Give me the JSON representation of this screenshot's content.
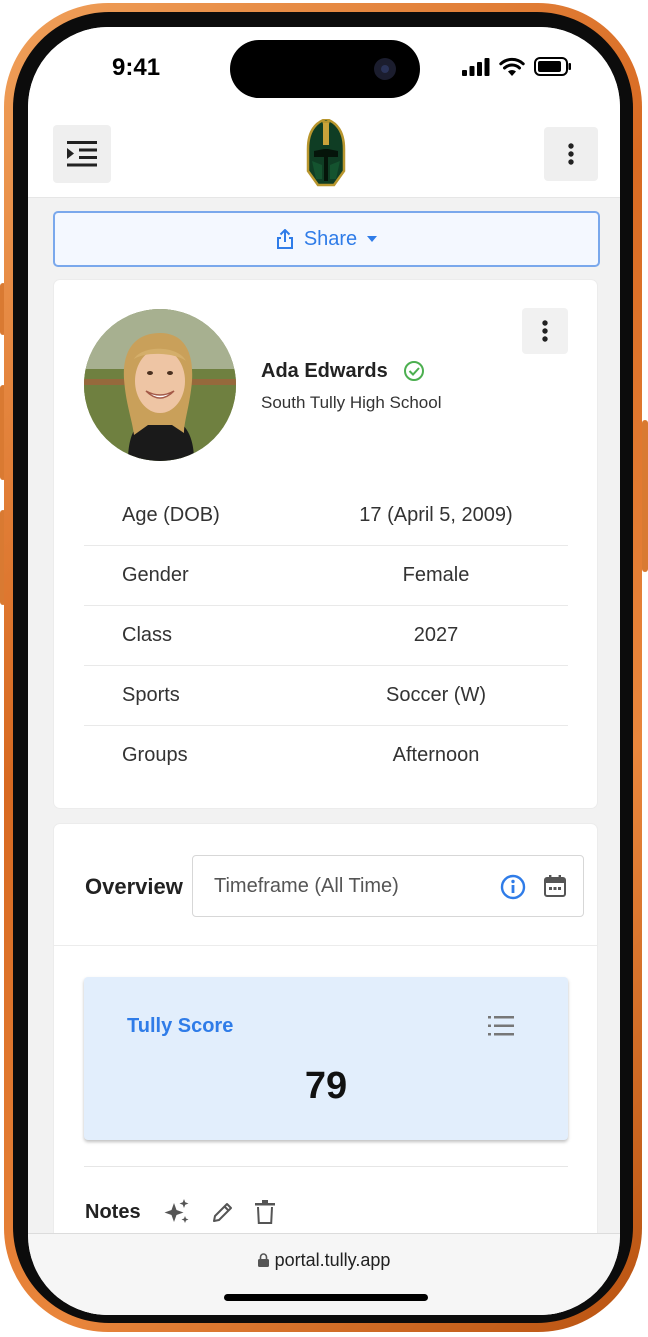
{
  "status_bar": {
    "time": "9:41"
  },
  "header": {
    "menu_icon": "indent-menu-icon",
    "logo": "spartan-helmet-logo",
    "more_icon": "more-vertical-icon"
  },
  "share": {
    "label": "Share",
    "icon": "share-upload-icon",
    "caret": "caret-down-icon"
  },
  "profile": {
    "name": "Ada Edwards",
    "school": "South Tully High School",
    "verified": true,
    "rows": [
      {
        "label": "Age (DOB)",
        "value": "17 (April 5, 2009)"
      },
      {
        "label": "Gender",
        "value": "Female"
      },
      {
        "label": "Class",
        "value": "2027"
      },
      {
        "label": "Sports",
        "value": "Soccer (W)"
      },
      {
        "label": "Groups",
        "value": "Afternoon"
      }
    ]
  },
  "overview": {
    "title": "Overview",
    "timeframe_placeholder": "Timeframe (All Time)",
    "score_label": "Tully Score",
    "score_value": "79",
    "notes_label": "Notes"
  },
  "browser": {
    "url": "portal.tully.app"
  },
  "colors": {
    "accent": "#2f7ce8",
    "frame": "#d86a22",
    "score_bg": "#e2eefc",
    "verified": "#4caf50"
  }
}
